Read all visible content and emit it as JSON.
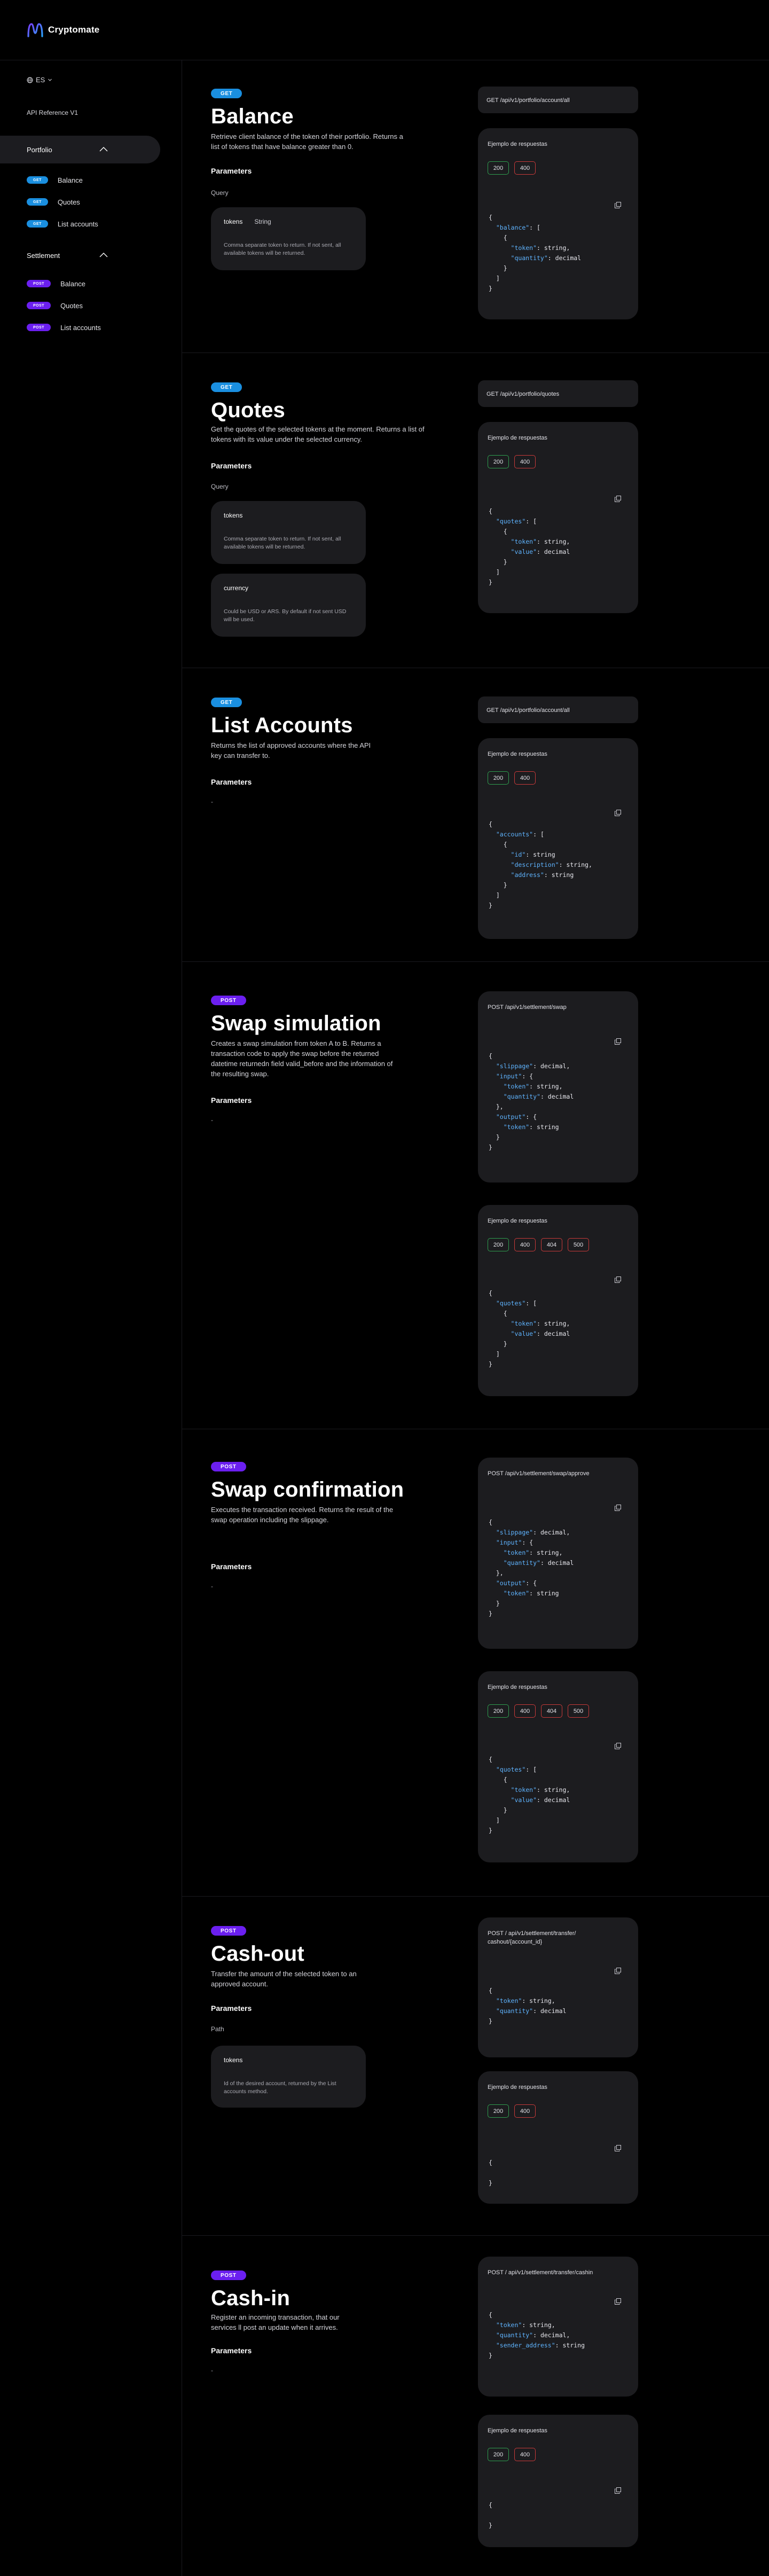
{
  "brand": {
    "name": "Cryptomate"
  },
  "sidebar": {
    "language": "ES",
    "api_reference": "API Reference V1",
    "groups": [
      {
        "label": "Portfolio",
        "items": [
          {
            "method": "GET",
            "label": "Balance"
          },
          {
            "method": "GET",
            "label": "Quotes"
          },
          {
            "method": "GET",
            "label": "List accounts"
          }
        ]
      },
      {
        "label": "Settlement",
        "items": [
          {
            "method": "POST",
            "label": "Balance"
          },
          {
            "method": "POST",
            "label": "Quotes"
          },
          {
            "method": "POST",
            "label": "List accounts"
          }
        ]
      }
    ]
  },
  "common": {
    "params_heading": "Parameters",
    "example_title": "Ejemplo de respuestas",
    "dash": "-"
  },
  "sections": [
    {
      "method": "GET",
      "title": "Balance",
      "description": "Retrieve client balance of the token of their portfolio. Returns a list of tokens that have balance greater than 0.",
      "param_location": "Query",
      "params": [
        {
          "name": "tokens",
          "type": "String",
          "description": "Comma separate token to return. If not sent, all available tokens will be returned."
        }
      ],
      "url": "GET /api/v1/portfolio/account/all",
      "response_codes": [
        "200",
        "400"
      ]
    },
    {
      "method": "GET",
      "title": "Quotes",
      "description": "Get the quotes of the selected tokens at the moment. Returns a list of tokens with its value under the selected currency.",
      "param_location": "Query",
      "params": [
        {
          "name": "tokens",
          "type": "",
          "description": "Comma separate token to return. If not sent, all available tokens will be returned."
        },
        {
          "name": "currency",
          "type": "",
          "description": "Could be USD or ARS. By default if not sent USD will be used."
        }
      ],
      "url": "GET /api/v1/portfolio/quotes",
      "response_codes": [
        "200",
        "400"
      ]
    },
    {
      "method": "GET",
      "title": "List Accounts",
      "description": "Returns the list of approved accounts where the API key can transfer to.",
      "url": "GET /api/v1/portfolio/account/all",
      "response_codes": [
        "200",
        "400"
      ]
    },
    {
      "method": "POST",
      "title": "Swap simulation",
      "description": "Creates a swap simulation from token A to B. Returns a transaction code to apply the swap before the returned datetime returnedn field valid_before and the information of the resulting swap.",
      "url": "POST /api/v1/settlement/swap",
      "response_codes": [
        "200",
        "400",
        "404",
        "500"
      ]
    },
    {
      "method": "POST",
      "title": "Swap confirmation",
      "description": "Executes the transaction received. Returns the result of the swap operation including the slippage.",
      "url": "POST /api/v1/settlement/swap/approve",
      "response_codes": [
        "200",
        "400",
        "404",
        "500"
      ]
    },
    {
      "method": "POST",
      "title": "Cash-out",
      "description": "Transfer the amount of the selected token to an approved account.",
      "param_location": "Path",
      "params": [
        {
          "name": "tokens",
          "type": "",
          "description": "Id of the desired account, returned by the List accounts method."
        }
      ],
      "url": "POST / api/v1/settlement/transfer/ cashout/{account_id}",
      "response_codes": [
        "200",
        "400"
      ]
    },
    {
      "method": "POST",
      "title": "Cash-in",
      "description": "Register an incoming transaction, that our services ll post an update when it arrives.",
      "url": "POST / api/v1/settlement/transfer/cashin",
      "response_codes": [
        "200",
        "400"
      ]
    }
  ]
}
